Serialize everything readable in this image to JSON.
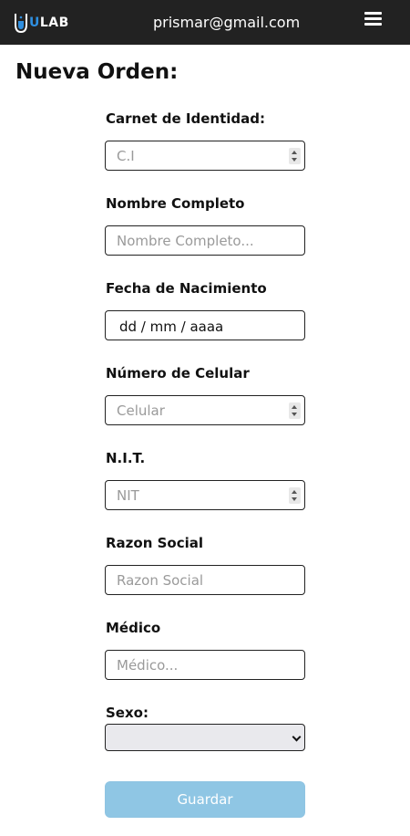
{
  "navbar": {
    "logo_prefix": "U",
    "logo_text": "LAB",
    "user_email": "prismar@gmail.com",
    "menu_icon": "hamburger-icon"
  },
  "page": {
    "title": "Nueva Orden:"
  },
  "form": {
    "ci": {
      "label": "Carnet de Identidad:",
      "placeholder": "C.I"
    },
    "nombre": {
      "label": "Nombre Completo",
      "placeholder": "Nombre Completo..."
    },
    "fecha": {
      "label": "Fecha de Nacimiento",
      "value": "dd / mm / aaaa"
    },
    "celular": {
      "label": "Número de Celular",
      "placeholder": "Celular"
    },
    "nit": {
      "label": "N.I.T.",
      "placeholder": "NIT"
    },
    "razon": {
      "label": "Razon Social",
      "placeholder": "Razon Social"
    },
    "medico": {
      "label": "Médico",
      "placeholder": "Médico..."
    },
    "sexo": {
      "label": "Sexo:",
      "value": ""
    },
    "submit_label": "Guardar"
  },
  "colors": {
    "navbar_bg": "#222222",
    "accent_blue": "#2f8fe0",
    "button_bg": "#8fc6e4"
  }
}
